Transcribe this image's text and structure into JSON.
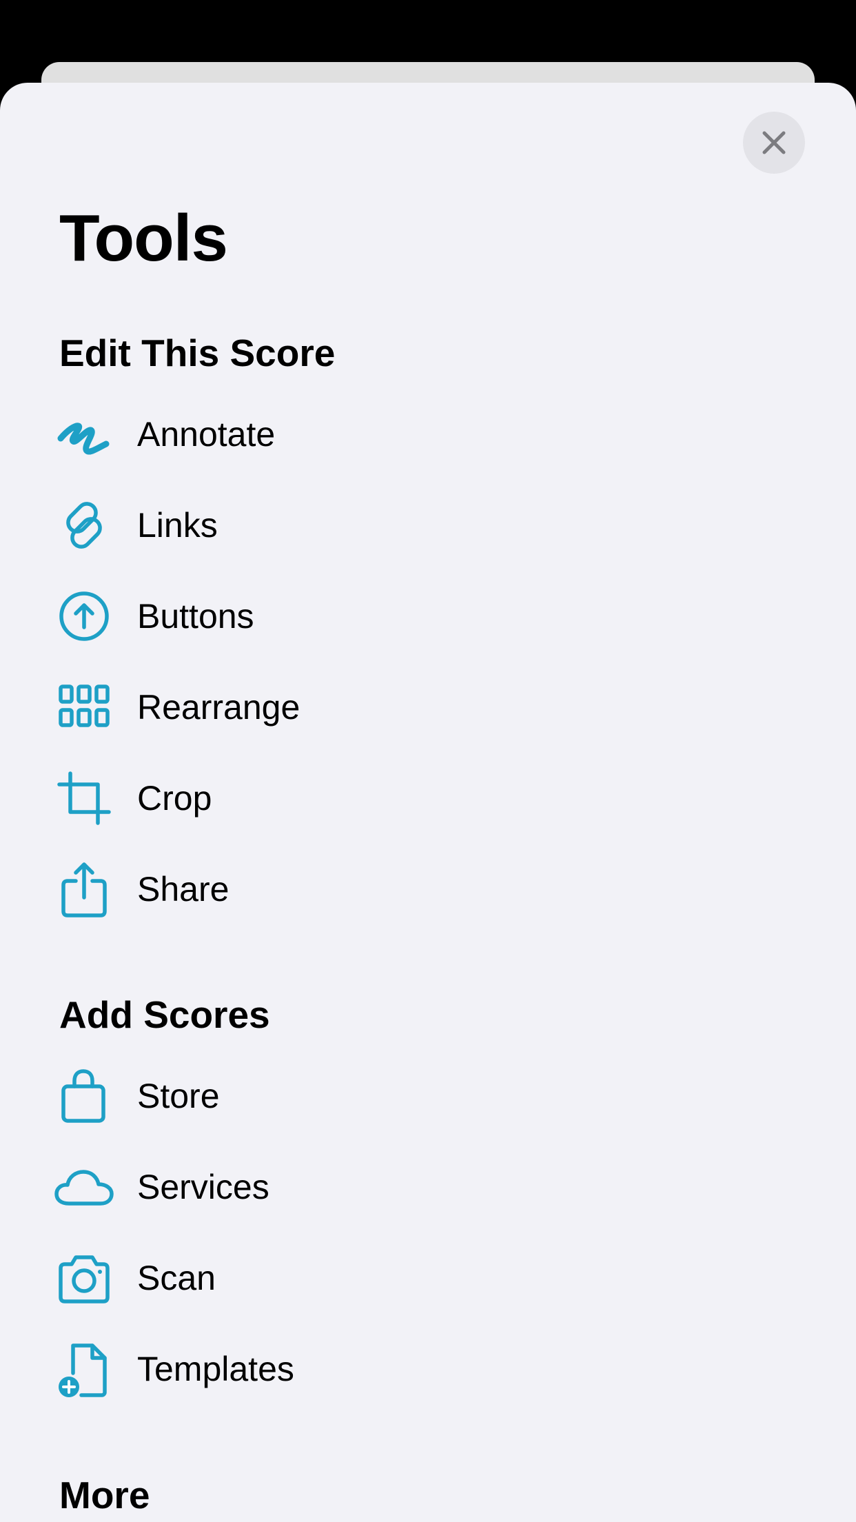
{
  "colors": {
    "accent": "#1ea0c6",
    "sheet_bg": "#f2f2f7",
    "close_bg": "#e3e3e8",
    "close_glyph": "#7c7c80"
  },
  "header": {
    "title": "Tools",
    "close_icon": "xmark-icon"
  },
  "sections": [
    {
      "title": "Edit This Score",
      "items": [
        {
          "label": "Annotate",
          "icon": "scribble-icon"
        },
        {
          "label": "Links",
          "icon": "link-icon"
        },
        {
          "label": "Buttons",
          "icon": "arrow-up-circle-icon"
        },
        {
          "label": "Rearrange",
          "icon": "grid-icon"
        },
        {
          "label": "Crop",
          "icon": "crop-icon"
        },
        {
          "label": "Share",
          "icon": "share-icon"
        }
      ]
    },
    {
      "title": "Add Scores",
      "items": [
        {
          "label": "Store",
          "icon": "bag-icon"
        },
        {
          "label": "Services",
          "icon": "cloud-icon"
        },
        {
          "label": "Scan",
          "icon": "camera-icon"
        },
        {
          "label": "Templates",
          "icon": "document-plus-icon"
        }
      ]
    },
    {
      "title": "More",
      "items": []
    }
  ]
}
